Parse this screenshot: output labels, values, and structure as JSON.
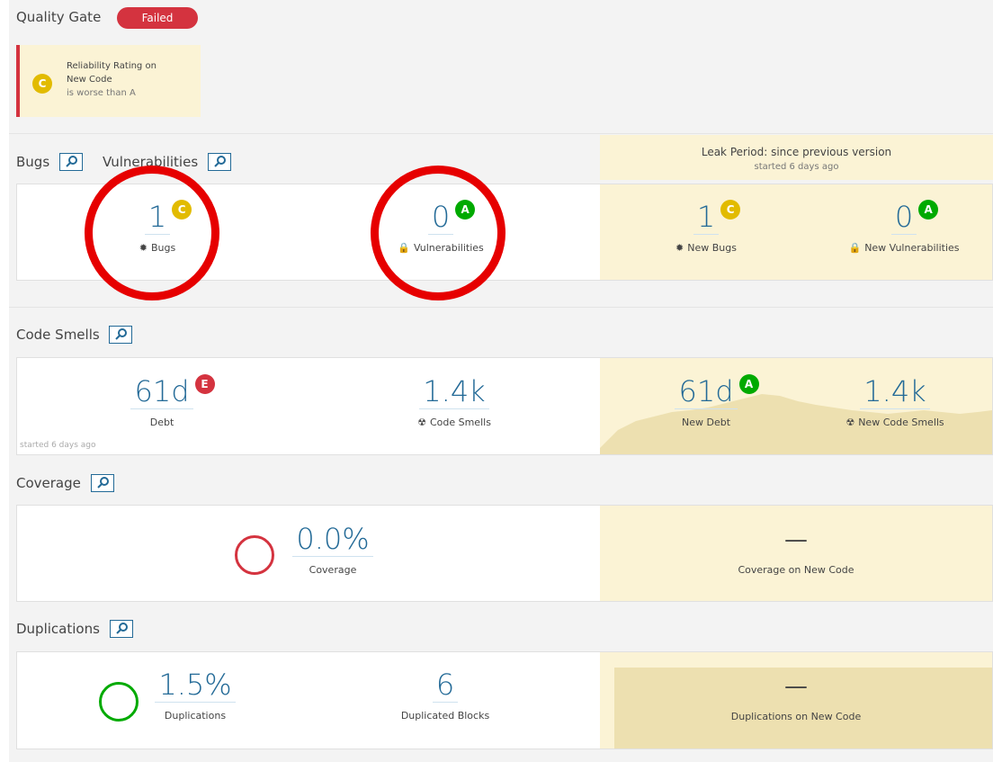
{
  "quality_gate": {
    "title": "Quality Gate",
    "status": "Failed",
    "condition": {
      "rating": "C",
      "line1": "Reliability Rating on",
      "line2": "New Code",
      "line3": "is worse than A"
    }
  },
  "leak_period": {
    "title": "Leak Period: since previous version",
    "started": "started 6 days ago"
  },
  "bugs_section": {
    "bugs_title": "Bugs",
    "vuln_title": "Vulnerabilities",
    "bugs": {
      "value": "1",
      "rating": "C",
      "label": "Bugs",
      "icon": "bug-icon"
    },
    "vulnerabilities": {
      "value": "0",
      "rating": "A",
      "label": "Vulnerabilities",
      "icon": "lock-icon"
    },
    "new_bugs": {
      "value": "1",
      "rating": "C",
      "label": "New Bugs"
    },
    "new_vulnerabilities": {
      "value": "0",
      "rating": "A",
      "label": "New Vulnerabilities"
    }
  },
  "code_smells_section": {
    "title": "Code Smells",
    "debt": {
      "value": "61d",
      "rating": "E",
      "label": "Debt",
      "started": "started 6 days ago"
    },
    "code_smells": {
      "value": "1.4k",
      "label": "Code Smells",
      "icon": "radiation-icon"
    },
    "new_debt": {
      "value": "61d",
      "rating": "A",
      "label": "New Debt"
    },
    "new_code_smells": {
      "value": "1.4k",
      "label": "New Code Smells"
    }
  },
  "coverage_section": {
    "title": "Coverage",
    "coverage": {
      "value": "0.0%",
      "label": "Coverage",
      "percent": 0
    },
    "new_coverage": {
      "value": "—",
      "label": "Coverage on New Code"
    }
  },
  "duplications_section": {
    "title": "Duplications",
    "duplications": {
      "value": "1.5%",
      "label": "Duplications"
    },
    "duplicated_blocks": {
      "value": "6",
      "label": "Duplicated Blocks"
    },
    "new_duplications": {
      "value": "—",
      "label": "Duplications on New Code"
    }
  },
  "colors": {
    "link": "#236a97",
    "failed": "#d4333f",
    "rating_a": "#00aa00",
    "rating_c": "#e2bb00",
    "rating_e": "#d4333f",
    "leak_bg": "#fbf3d5",
    "annotation_ring": "#e60000"
  }
}
